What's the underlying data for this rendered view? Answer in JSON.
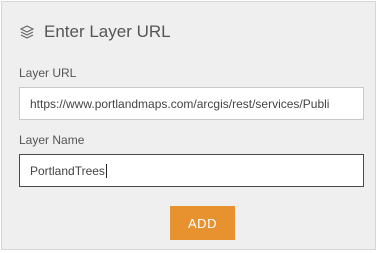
{
  "header": {
    "icon": "layers-icon",
    "title": "Enter Layer URL"
  },
  "form": {
    "url_label": "Layer URL",
    "url_value": "https://www.portlandmaps.com/arcgis/rest/services/Publi",
    "name_label": "Layer Name",
    "name_value": "PortlandTrees",
    "add_label": "ADD"
  },
  "colors": {
    "accent": "#e8912f",
    "panel_bg": "#efefef",
    "text": "#555555"
  }
}
